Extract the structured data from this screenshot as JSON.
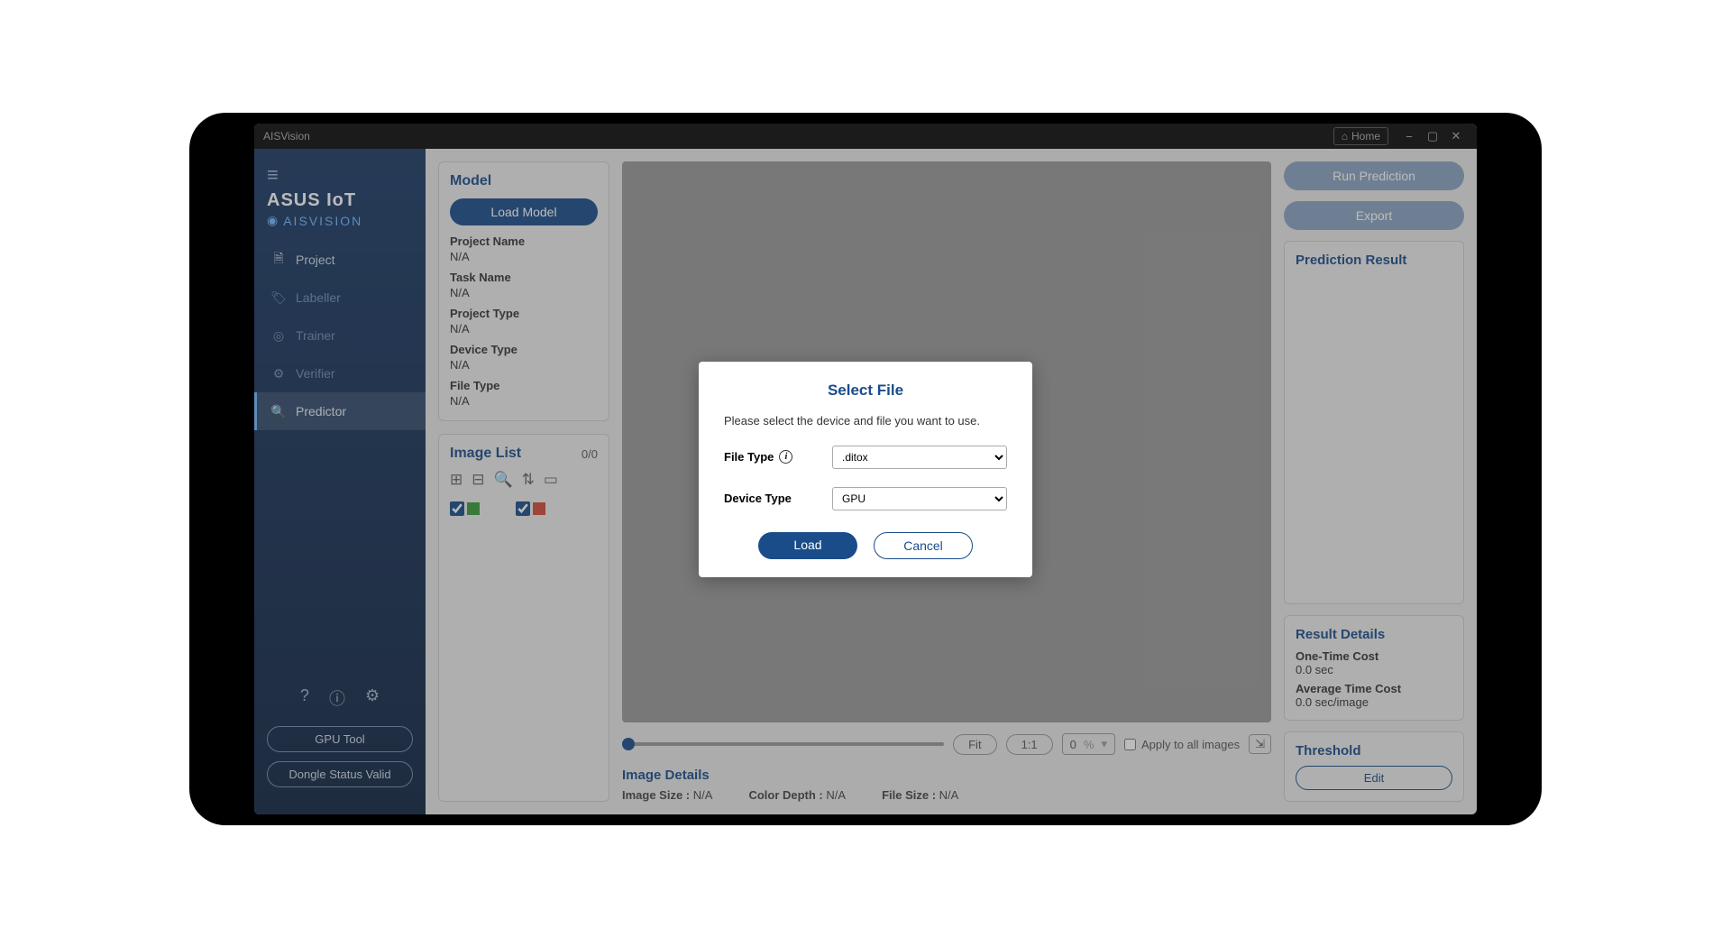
{
  "titlebar": {
    "app_name": "AISVision",
    "home_label": "Home"
  },
  "sidebar": {
    "brand1": "ASUS IoT",
    "brand2": "AISVISION",
    "items": [
      {
        "label": "Project"
      },
      {
        "label": "Labeller"
      },
      {
        "label": "Trainer"
      },
      {
        "label": "Verifier"
      },
      {
        "label": "Predictor"
      }
    ],
    "gpu_tool": "GPU Tool",
    "dongle_status": "Dongle Status Valid"
  },
  "model_panel": {
    "title": "Model",
    "load_btn": "Load Model",
    "project_name_lbl": "Project Name",
    "project_name": "N/A",
    "task_name_lbl": "Task Name",
    "task_name": "N/A",
    "project_type_lbl": "Project Type",
    "project_type": "N/A",
    "device_type_lbl": "Device Type",
    "device_type": "N/A",
    "file_type_lbl": "File Type",
    "file_type": "N/A"
  },
  "image_list": {
    "title": "Image List",
    "count": "0/0"
  },
  "zoom": {
    "fit": "Fit",
    "one": "1:1",
    "value": "0",
    "unit": "%",
    "apply_all": "Apply to all images"
  },
  "image_details": {
    "title": "Image Details",
    "size_lbl": "Image Size :",
    "size": "N/A",
    "depth_lbl": "Color Depth :",
    "depth": "N/A",
    "fsize_lbl": "File Size :",
    "fsize": "N/A"
  },
  "right": {
    "run": "Run Prediction",
    "export": "Export",
    "pred_result": "Prediction Result",
    "result_details": "Result Details",
    "one_time_lbl": "One-Time Cost",
    "one_time": "0.0 sec",
    "avg_lbl": "Average Time Cost",
    "avg": "0.0 sec/image",
    "threshold": "Threshold",
    "edit": "Edit"
  },
  "dialog": {
    "title": "Select File",
    "msg": "Please select the device and file you want to use.",
    "file_type_lbl": "File Type",
    "file_type_val": ".ditox",
    "device_type_lbl": "Device Type",
    "device_type_val": "GPU",
    "load": "Load",
    "cancel": "Cancel"
  }
}
